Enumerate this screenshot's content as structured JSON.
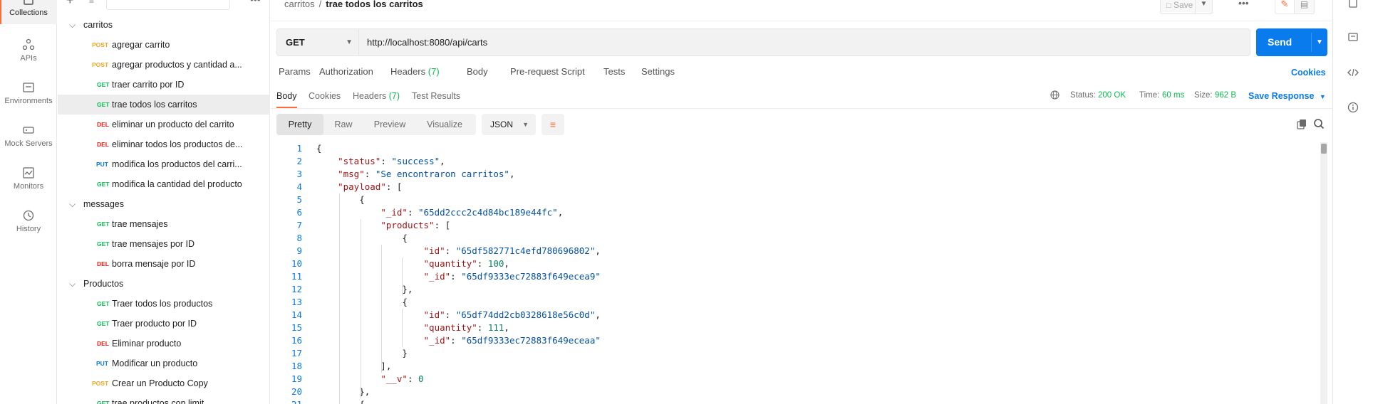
{
  "rail": {
    "items": [
      {
        "label": "Collections",
        "icon": "collections-icon"
      },
      {
        "label": "APIs",
        "icon": "apis-icon"
      },
      {
        "label": "Environments",
        "icon": "environments-icon"
      },
      {
        "label": "Mock Servers",
        "icon": "mock-servers-icon"
      },
      {
        "label": "Monitors",
        "icon": "monitors-icon"
      },
      {
        "label": "History",
        "icon": "history-icon"
      }
    ]
  },
  "sidebar": {
    "toolbar": {
      "add": "+",
      "filter": "≡",
      "more": "•••"
    },
    "tree": [
      {
        "type": "folder",
        "name": "carritos"
      },
      {
        "type": "request",
        "method": "POST",
        "name": "agregar carrito"
      },
      {
        "type": "request",
        "method": "POST",
        "name": "agregar productos y cantidad a..."
      },
      {
        "type": "request",
        "method": "GET",
        "name": "traer carrito por ID"
      },
      {
        "type": "request",
        "method": "GET",
        "name": "trae todos los carritos",
        "selected": true
      },
      {
        "type": "request",
        "method": "DEL",
        "name": "eliminar un producto del carrito"
      },
      {
        "type": "request",
        "method": "DEL",
        "name": "eliminar todos los productos de..."
      },
      {
        "type": "request",
        "method": "PUT",
        "name": "modifica los productos del carri..."
      },
      {
        "type": "request",
        "method": "GET",
        "name": "modifica la cantidad del producto"
      },
      {
        "type": "folder",
        "name": "messages"
      },
      {
        "type": "request",
        "method": "GET",
        "name": "trae mensajes"
      },
      {
        "type": "request",
        "method": "GET",
        "name": "trae mensajes por ID"
      },
      {
        "type": "request",
        "method": "DEL",
        "name": "borra mensaje por ID"
      },
      {
        "type": "folder",
        "name": "Productos"
      },
      {
        "type": "request",
        "method": "GET",
        "name": "Traer todos los productos"
      },
      {
        "type": "request",
        "method": "GET",
        "name": "Traer producto por ID"
      },
      {
        "type": "request",
        "method": "DEL",
        "name": "Eliminar producto"
      },
      {
        "type": "request",
        "method": "PUT",
        "name": "Modificar un producto"
      },
      {
        "type": "request",
        "method": "POST",
        "name": "Crear un Producto Copy"
      },
      {
        "type": "request",
        "method": "GET",
        "name": "trae productos con limit"
      }
    ]
  },
  "header": {
    "breadcrumb": {
      "parent": "carritos",
      "separator": "/",
      "current": "trae todos los carritos"
    },
    "save_label": "Save",
    "more": "•••"
  },
  "request": {
    "method": "GET",
    "url": "http://localhost:8080/api/carts",
    "send_label": "Send",
    "tabs": [
      {
        "label": "Params"
      },
      {
        "label": "Authorization"
      },
      {
        "label": "Headers",
        "count": "(7)"
      },
      {
        "label": "Body"
      },
      {
        "label": "Pre-request Script"
      },
      {
        "label": "Tests"
      },
      {
        "label": "Settings"
      }
    ],
    "cookies_label": "Cookies"
  },
  "response": {
    "tabs": [
      {
        "label": "Body",
        "active": true
      },
      {
        "label": "Cookies"
      },
      {
        "label": "Headers",
        "count": "(7)"
      },
      {
        "label": "Test Results"
      }
    ],
    "status_label": "Status:",
    "status_value": "200 OK",
    "time_label": "Time:",
    "time_value": "60 ms",
    "size_label": "Size:",
    "size_value": "962 B",
    "save_response_label": "Save Response",
    "views": [
      "Pretty",
      "Raw",
      "Preview",
      "Visualize"
    ],
    "active_view": "Pretty",
    "format": "JSON",
    "code_lines": [
      "{",
      "    \"status\": \"success\",",
      "    \"msg\": \"Se encontraron carritos\",",
      "    \"payload\": [",
      "        {",
      "            \"_id\": \"65dd2ccc2c4d84bc189e44fc\",",
      "            \"products\": [",
      "                {",
      "                    \"id\": \"65df582771c4efd780696802\",",
      "                    \"quantity\": 100,",
      "                    \"_id\": \"65df9333ec72883f649ecea9\"",
      "                },",
      "                {",
      "                    \"id\": \"65df74dd2cb0328618e56c0d\",",
      "                    \"quantity\": 111,",
      "                    \"_id\": \"65df9333ec72883f649eceaa\"",
      "                }",
      "            ],",
      "            \"__v\": 0",
      "        },",
      "        {"
    ]
  },
  "colors": {
    "accent": "#ff6c37",
    "send": "#097bed",
    "get": "#0cbb52",
    "post": "#f5a623",
    "del": "#eb2013",
    "put": "#097bed"
  }
}
